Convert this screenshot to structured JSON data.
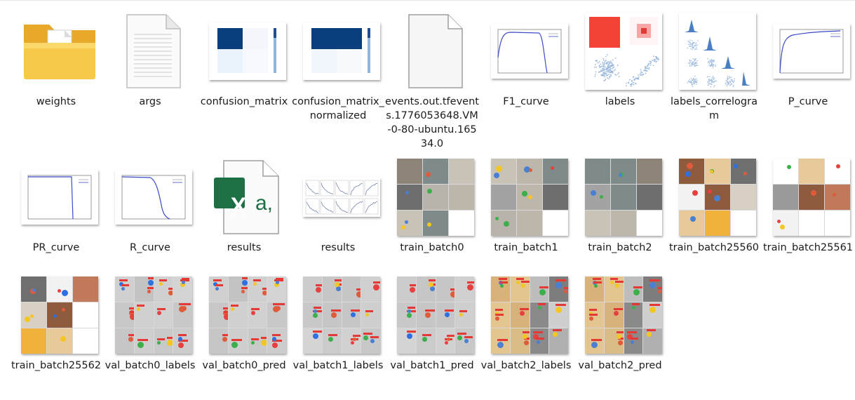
{
  "explorer": {
    "items": [
      {
        "name": "weights",
        "icon": "folder-icon"
      },
      {
        "name": "args",
        "icon": "text-file-icon"
      },
      {
        "name": "confusion_matrix",
        "icon": "confusion-matrix-thumbnail"
      },
      {
        "name": "confusion_matrix_normalized",
        "icon": "confusion-matrix-thumbnail"
      },
      {
        "name": "events.out.tfevents.1776053648.VM-0-80-ubuntu.16534.0",
        "icon": "blank-file-icon"
      },
      {
        "name": "F1_curve",
        "icon": "curve-thumbnail"
      },
      {
        "name": "labels",
        "icon": "labels-thumbnail"
      },
      {
        "name": "labels_correlogram",
        "icon": "correlogram-thumbnail"
      },
      {
        "name": "P_curve",
        "icon": "curve-thumbnail"
      },
      {
        "name": "PR_curve",
        "icon": "curve-thumbnail"
      },
      {
        "name": "R_curve",
        "icon": "curve-thumbnail"
      },
      {
        "name": "results",
        "icon": "excel-csv-icon"
      },
      {
        "name": "results",
        "icon": "results-plots-thumbnail"
      },
      {
        "name": "train_batch0",
        "icon": "train-batch-thumbnail"
      },
      {
        "name": "train_batch1",
        "icon": "train-batch-thumbnail"
      },
      {
        "name": "train_batch2",
        "icon": "train-batch-thumbnail"
      },
      {
        "name": "train_batch25560",
        "icon": "train-batch-thumbnail"
      },
      {
        "name": "train_batch25561",
        "icon": "train-batch-thumbnail"
      },
      {
        "name": "train_batch25562",
        "icon": "train-batch-thumbnail"
      },
      {
        "name": "val_batch0_labels",
        "icon": "val-batch-thumbnail"
      },
      {
        "name": "val_batch0_pred",
        "icon": "val-batch-thumbnail"
      },
      {
        "name": "val_batch1_labels",
        "icon": "val-batch-thumbnail"
      },
      {
        "name": "val_batch1_pred",
        "icon": "val-batch-thumbnail"
      },
      {
        "name": "val_batch2_labels",
        "icon": "val-batch-thumbnail"
      },
      {
        "name": "val_batch2_pred",
        "icon": "val-batch-thumbnail"
      }
    ],
    "excel_glyph": "X",
    "csv_glyph": "a,",
    "colors": {
      "folder": "#f4c244",
      "excel_green": "#1d7044",
      "curve_blue": "#3b4bc8",
      "matrix_dark": "#0b3e7c",
      "detect_red": "#e53935"
    }
  }
}
